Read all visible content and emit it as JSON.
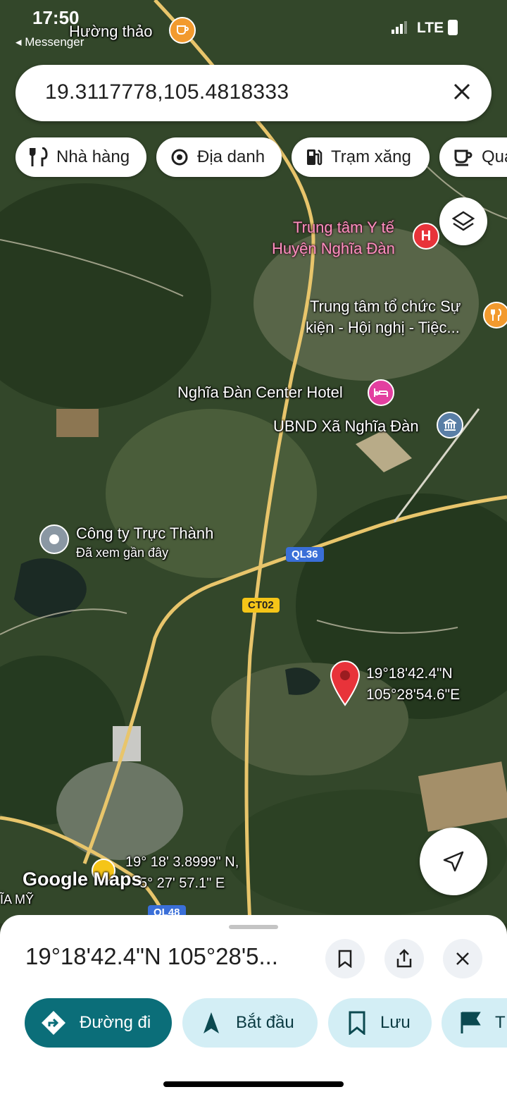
{
  "status_bar": {
    "time": "17:50",
    "back_label": "◂ Messenger",
    "network": "LTE"
  },
  "search": {
    "query": "19.3117778,105.4818333"
  },
  "chips": [
    {
      "label": "Nhà hàng",
      "icon": "restaurant-icon"
    },
    {
      "label": "Địa danh",
      "icon": "landmark-icon"
    },
    {
      "label": "Trạm xăng",
      "icon": "gas-station-icon"
    },
    {
      "label": "Quá",
      "icon": "cafe-icon"
    }
  ],
  "map_labels": {
    "huong_thao": "Hường thảo",
    "medical_center": [
      "Trung tâm Y tế",
      "Huyện Nghĩa Đàn"
    ],
    "event_center": [
      "Trung tâm tổ chức Sự",
      "kiện - Hội nghị - Tiệc..."
    ],
    "hotel": "Nghĩa Đàn Center Hotel",
    "ubnd": "UBND Xã Nghĩa Đàn",
    "company": "Công ty Trực Thành",
    "company_sub": "Đã xem gần đây",
    "pin_coords": [
      "19°18'42.4\"N",
      "105°28'54.6\"E"
    ],
    "road_ql36": "QL36",
    "road_ct02": "CT02",
    "road_ql48": "QL48",
    "overlay_coords": [
      "19° 18' 3.8999\" N,",
      "5° 27' 57.1\" E"
    ],
    "village_edge": "ĨA MỸ",
    "attribution": "Google Maps"
  },
  "sheet": {
    "title": "19°18'42.4\"N 105°28'5...",
    "actions": [
      {
        "label": "Đường đi",
        "icon": "directions-icon",
        "primary": true
      },
      {
        "label": "Bắt đầu",
        "icon": "navigation-arrow-icon"
      },
      {
        "label": "Lưu",
        "icon": "bookmark-icon"
      },
      {
        "label": "T",
        "icon": "flag-icon"
      }
    ]
  },
  "colors": {
    "primary": "#0b6e79",
    "pill_bg": "#d3eef5",
    "pin": "#e8333a",
    "road": "#e8c56b"
  }
}
